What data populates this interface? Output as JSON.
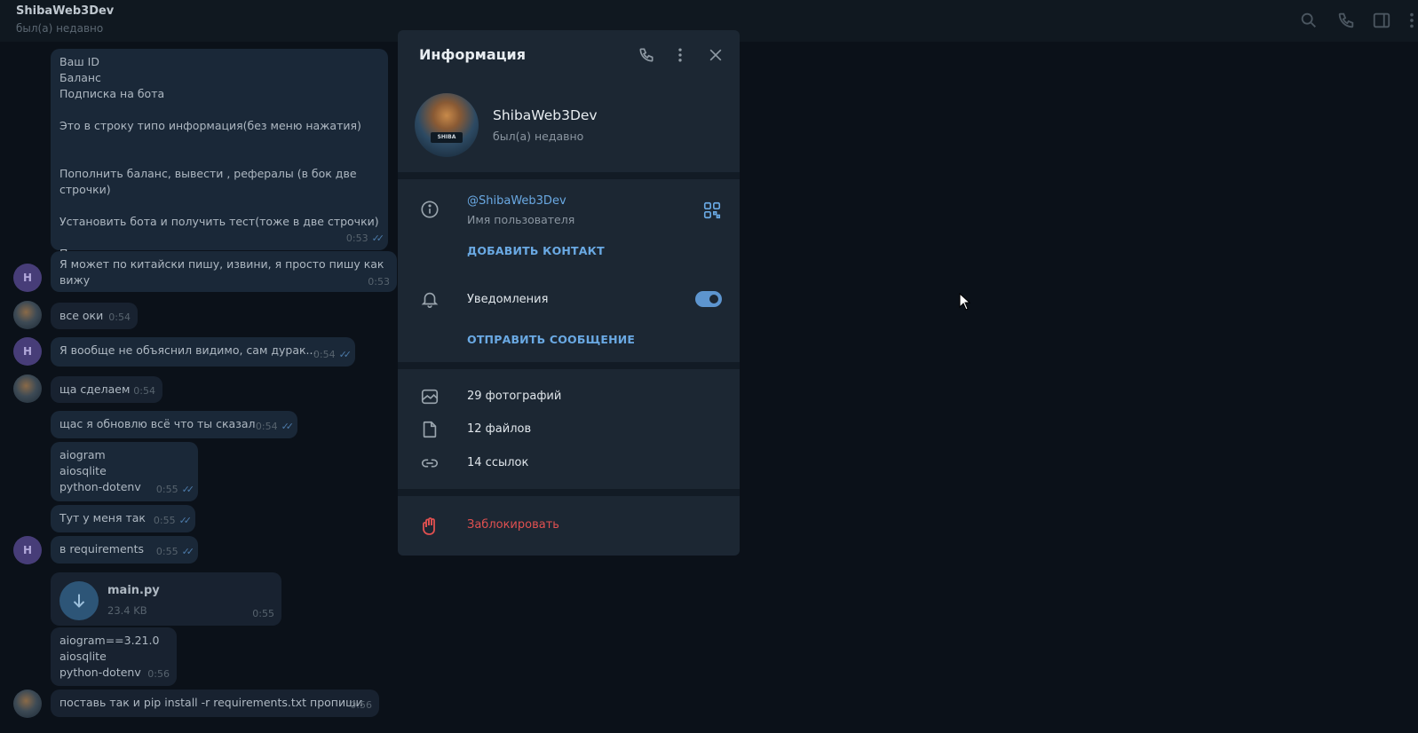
{
  "header": {
    "chat_name": "ShibaWeb3Dev",
    "chat_status": "был(а) недавно",
    "icons": [
      "search-icon",
      "phone-icon",
      "sidebar-icon",
      "more-icon"
    ]
  },
  "messages": [
    {
      "text": "Ваш ID\nБаланс\nПодписка на бота\n\nЭто в строку типо информация(без меню нажатия)\n\n\nПополнить баланс, вывести , рефералы (в бок две строчки)\n\nУстановить бота и получить тест(тоже в две строчки)\n\nПоддержка и наш канал вниз две строчки",
      "time": "0:53",
      "read": true
    },
    {
      "text": "Я может по китайски пишу, извини, я просто пишу как вижу",
      "time": "0:53",
      "read": false,
      "avatar": "Н"
    },
    {
      "text": "все оки",
      "time": "0:54",
      "read": false
    },
    {
      "text": "Я вообще не объяснил видимо, сам дурак...",
      "time": "0:54",
      "read": true,
      "avatar": "Н"
    },
    {
      "text": "ща сделаем",
      "time": "0:54",
      "read": false
    },
    {
      "text": "щас я обновлю всё что ты сказал",
      "time": "0:54",
      "read": true
    },
    {
      "text": "aiogram\naiosqlite\npython-dotenv",
      "time": "0:55",
      "read": true
    },
    {
      "text": "Тут у меня так",
      "time": "0:55",
      "read": true
    },
    {
      "text": "в requirements",
      "time": "0:55",
      "read": true,
      "avatar": "Н"
    },
    {
      "file_name": "main.py",
      "file_size": "23.4 KB",
      "time": "0:55"
    },
    {
      "text": "aiogram==3.21.0\naiosqlite\npython-dotenv",
      "time": "0:56",
      "read": false
    },
    {
      "text": "поставь так и pip install -r requirements.txt пропиши",
      "time": "0:56",
      "read": false
    }
  ],
  "panel": {
    "title": "Информация",
    "profile_name": "ShibaWeb3Dev",
    "profile_status": "был(а) недавно",
    "avatar_badge": "SHIBA",
    "username": "@ShibaWeb3Dev",
    "username_label": "Имя пользователя",
    "add_contact": "ДОБАВИТЬ КОНТАКТ",
    "notifications_label": "Уведомления",
    "notifications_on": true,
    "send_message": "ОТПРАВИТЬ СООБЩЕНИЕ",
    "photos": "29 фотографий",
    "files": "12 файлов",
    "links": "14 ссылок",
    "block": "Заблокировать"
  },
  "colors": {
    "accent": "#6aa9e3",
    "danger": "#e05050",
    "panel_bg": "#1c2733",
    "chat_bg": "#0b1119"
  }
}
